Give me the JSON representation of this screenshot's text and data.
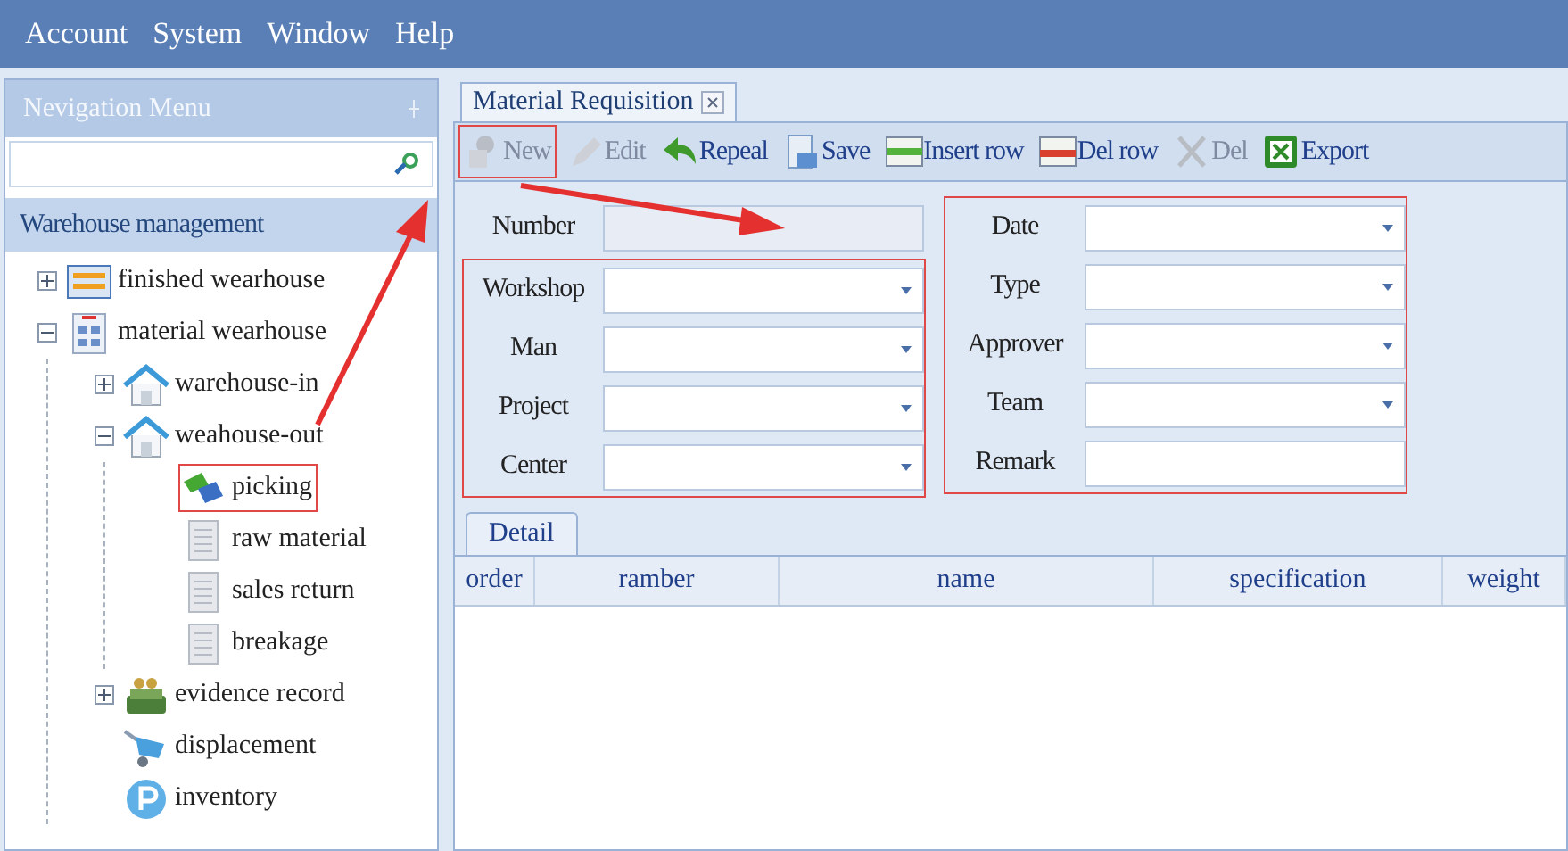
{
  "menu_bar": {
    "items": [
      "Account",
      "System",
      "Window",
      "Help"
    ]
  },
  "sidebar": {
    "title": "Nevigation Menu",
    "section": "Warehouse management",
    "tree": [
      {
        "label": "finished wearhouse",
        "kind": "list",
        "expanded": false,
        "highlighted": false
      },
      {
        "label": "material wearhouse",
        "kind": "grid",
        "expanded": true,
        "highlighted": false,
        "children": [
          {
            "label": "warehouse-in",
            "kind": "house",
            "expanded": false,
            "highlighted": false
          },
          {
            "label": "weahouse-out",
            "kind": "house",
            "expanded": true,
            "highlighted": false,
            "children": [
              {
                "label": "picking",
                "kind": "pick",
                "highlighted": true
              },
              {
                "label": "raw material",
                "kind": "doc",
                "highlighted": false
              },
              {
                "label": "sales return",
                "kind": "doc",
                "highlighted": false
              },
              {
                "label": "breakage",
                "kind": "doc",
                "highlighted": false
              }
            ]
          },
          {
            "label": "evidence record",
            "kind": "money",
            "expanded": false,
            "highlighted": false
          },
          {
            "label": "displacement",
            "kind": "cart",
            "highlighted": false
          },
          {
            "label": "inventory",
            "kind": "p",
            "highlighted": false
          }
        ]
      }
    ]
  },
  "tab": {
    "label": "Material Requisition"
  },
  "toolbar": [
    {
      "label": "New",
      "kind": "new",
      "disabled": true,
      "highlighted": true
    },
    {
      "label": "Edit",
      "kind": "edit",
      "disabled": true,
      "highlighted": false
    },
    {
      "label": "Repeal",
      "kind": "repeal",
      "disabled": false,
      "highlighted": false
    },
    {
      "label": "Save",
      "kind": "save",
      "disabled": false,
      "highlighted": false
    },
    {
      "label": "Insert row",
      "kind": "insert",
      "disabled": false,
      "highlighted": false
    },
    {
      "label": "Del row",
      "kind": "delrow",
      "disabled": false,
      "highlighted": false
    },
    {
      "label": "Del",
      "kind": "del",
      "disabled": true,
      "highlighted": false
    },
    {
      "label": "Export",
      "kind": "export",
      "disabled": false,
      "highlighted": false
    }
  ],
  "form": {
    "columns": [
      {
        "groups": [
          {
            "highlighted": false,
            "fields": [
              {
                "label": "Number",
                "kind": "text",
                "disabled": true
              }
            ]
          },
          {
            "highlighted": true,
            "fields": [
              {
                "label": "Workshop",
                "kind": "dropdown",
                "disabled": false
              },
              {
                "label": "Man",
                "kind": "dropdown",
                "disabled": false
              },
              {
                "label": "Project",
                "kind": "dropdown",
                "disabled": false
              },
              {
                "label": "Center",
                "kind": "dropdown",
                "disabled": false
              }
            ]
          }
        ]
      },
      {
        "groups": [
          {
            "highlighted": true,
            "fields": [
              {
                "label": "Date",
                "kind": "dropdown",
                "disabled": false
              },
              {
                "label": "Type",
                "kind": "dropdown",
                "disabled": false
              },
              {
                "label": "Approver",
                "kind": "dropdown",
                "disabled": false
              },
              {
                "label": "Team",
                "kind": "dropdown",
                "disabled": false
              },
              {
                "label": "Remark",
                "kind": "text",
                "disabled": false
              }
            ]
          }
        ]
      }
    ]
  },
  "detail": {
    "tab": "Detail",
    "columns": [
      "order",
      "ramber",
      "name",
      "specification",
      "weight"
    ]
  }
}
